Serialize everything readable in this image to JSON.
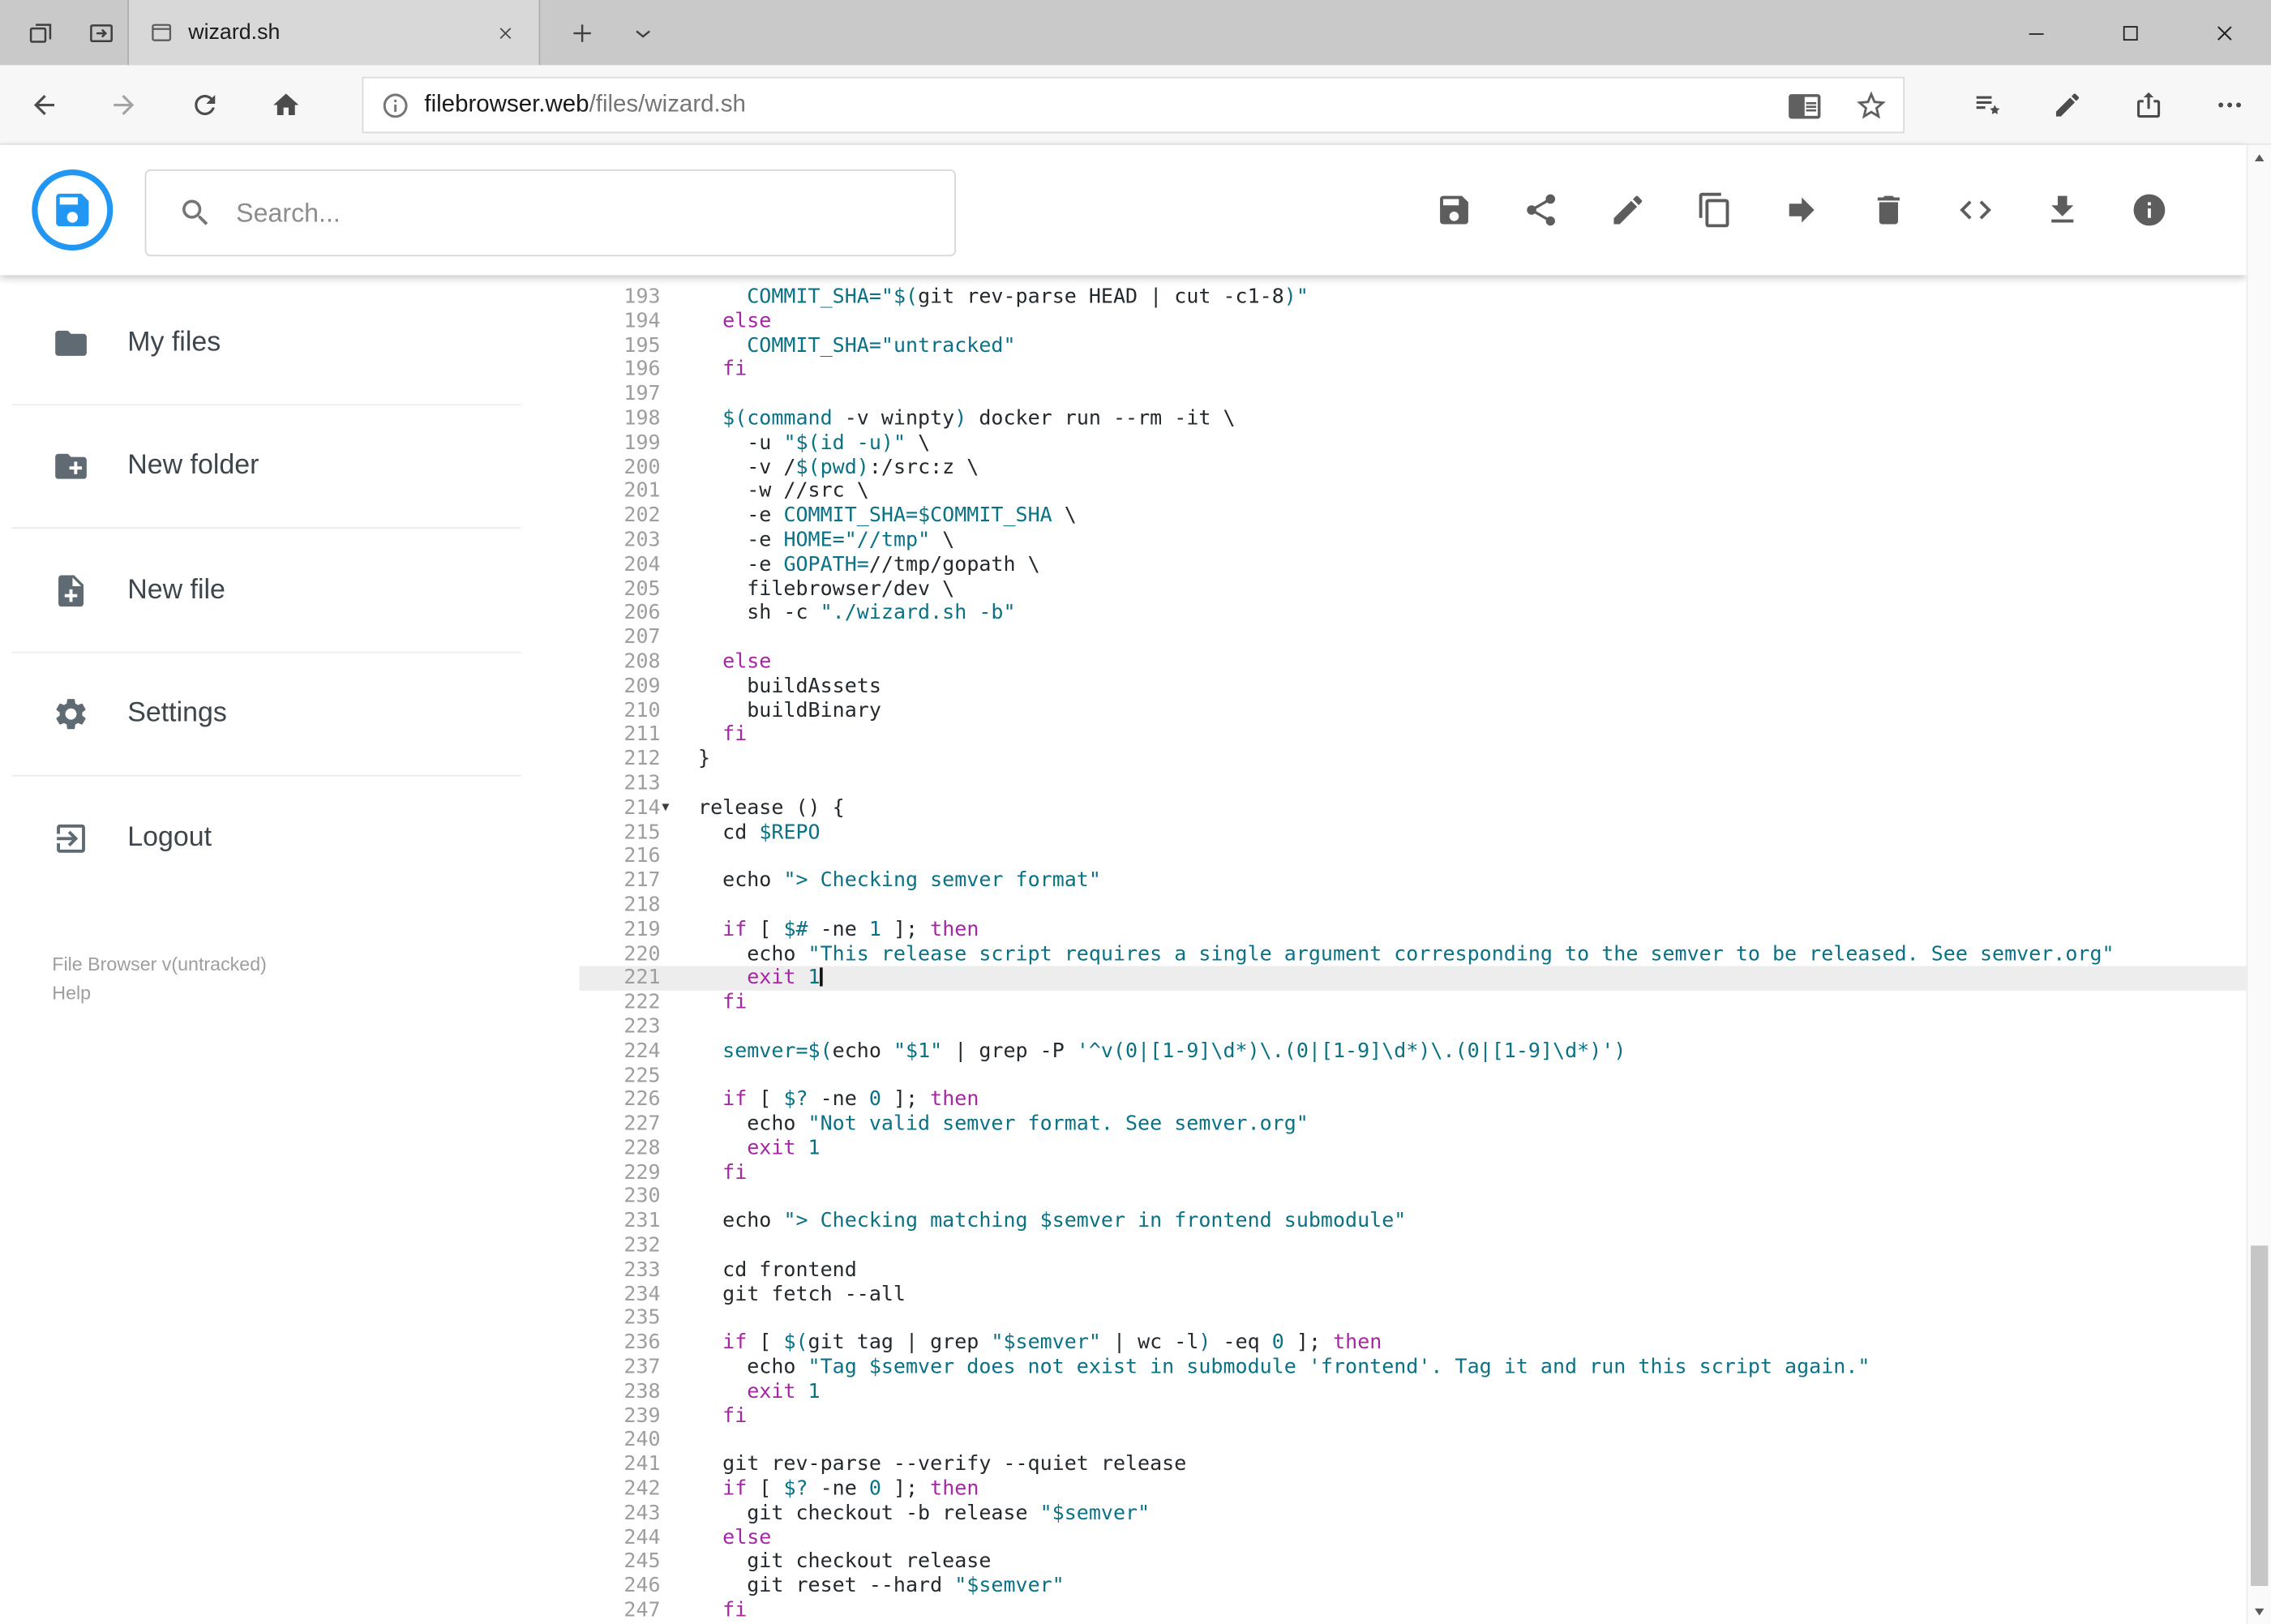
{
  "browser_tab": {
    "title": "wizard.sh"
  },
  "address_bar": {
    "domain": "filebrowser.web",
    "path": "/files/wizard.sh"
  },
  "header": {
    "search_placeholder": "Search..."
  },
  "sidebar": {
    "items": [
      {
        "label": "My files"
      },
      {
        "label": "New folder"
      },
      {
        "label": "New file"
      },
      {
        "label": "Settings"
      },
      {
        "label": "Logout"
      }
    ],
    "footer_version": "File Browser v(untracked)",
    "footer_help": "Help"
  },
  "colors": {
    "accent": "#2196f3",
    "keyword_color": "#a626a4",
    "token_color": "#0b7285"
  },
  "editor": {
    "active_line": 221,
    "cursor_line": 221,
    "fold_line": 214,
    "lines": [
      {
        "n": 193,
        "s": [
          [
            "p",
            "    "
          ],
          [
            "t",
            "COMMIT_SHA="
          ],
          [
            "t",
            "\"$("
          ],
          [
            "p",
            "git rev-parse HEAD | cut -c1-8"
          ],
          [
            "t",
            ")\""
          ]
        ]
      },
      {
        "n": 194,
        "s": [
          [
            "p",
            "  "
          ],
          [
            "k",
            "else"
          ]
        ]
      },
      {
        "n": 195,
        "s": [
          [
            "p",
            "    "
          ],
          [
            "t",
            "COMMIT_SHA="
          ],
          [
            "t",
            "\"untracked\""
          ]
        ]
      },
      {
        "n": 196,
        "s": [
          [
            "p",
            "  "
          ],
          [
            "k",
            "fi"
          ]
        ]
      },
      {
        "n": 197,
        "s": []
      },
      {
        "n": 198,
        "s": [
          [
            "p",
            "  "
          ],
          [
            "t",
            "$(command"
          ],
          [
            "p",
            " -v winpty"
          ],
          [
            "t",
            ")"
          ],
          [
            "p",
            " docker run --rm -it \\"
          ]
        ]
      },
      {
        "n": 199,
        "s": [
          [
            "p",
            "    -u "
          ],
          [
            "t",
            "\"$(id -u)\""
          ],
          [
            "p",
            " \\"
          ]
        ]
      },
      {
        "n": 200,
        "s": [
          [
            "p",
            "    -v /"
          ],
          [
            "t",
            "$(pwd)"
          ],
          [
            "p",
            ":/src:z \\"
          ]
        ]
      },
      {
        "n": 201,
        "s": [
          [
            "p",
            "    -w //src \\"
          ]
        ]
      },
      {
        "n": 202,
        "s": [
          [
            "p",
            "    -e "
          ],
          [
            "t",
            "COMMIT_SHA=$COMMIT_SHA"
          ],
          [
            "p",
            " \\"
          ]
        ]
      },
      {
        "n": 203,
        "s": [
          [
            "p",
            "    -e "
          ],
          [
            "t",
            "HOME="
          ],
          [
            "t",
            "\"//tmp\""
          ],
          [
            "p",
            " \\"
          ]
        ]
      },
      {
        "n": 204,
        "s": [
          [
            "p",
            "    -e "
          ],
          [
            "t",
            "GOPATH="
          ],
          [
            "p",
            "//tmp/gopath \\"
          ]
        ]
      },
      {
        "n": 205,
        "s": [
          [
            "p",
            "    filebrowser/dev \\"
          ]
        ]
      },
      {
        "n": 206,
        "s": [
          [
            "p",
            "    sh -c "
          ],
          [
            "t",
            "\"./wizard.sh -b\""
          ]
        ]
      },
      {
        "n": 207,
        "s": []
      },
      {
        "n": 208,
        "s": [
          [
            "p",
            "  "
          ],
          [
            "k",
            "else"
          ]
        ]
      },
      {
        "n": 209,
        "s": [
          [
            "p",
            "    buildAssets"
          ]
        ]
      },
      {
        "n": 210,
        "s": [
          [
            "p",
            "    buildBinary"
          ]
        ]
      },
      {
        "n": 211,
        "s": [
          [
            "p",
            "  "
          ],
          [
            "k",
            "fi"
          ]
        ]
      },
      {
        "n": 212,
        "s": [
          [
            "p",
            "}"
          ]
        ]
      },
      {
        "n": 213,
        "s": []
      },
      {
        "n": 214,
        "s": [
          [
            "p",
            "release () {"
          ]
        ]
      },
      {
        "n": 215,
        "s": [
          [
            "p",
            "  cd "
          ],
          [
            "t",
            "$REPO"
          ]
        ]
      },
      {
        "n": 216,
        "s": []
      },
      {
        "n": 217,
        "s": [
          [
            "p",
            "  echo "
          ],
          [
            "t",
            "\"> Checking semver format\""
          ]
        ]
      },
      {
        "n": 218,
        "s": []
      },
      {
        "n": 219,
        "s": [
          [
            "p",
            "  "
          ],
          [
            "k",
            "if"
          ],
          [
            "p",
            " [ "
          ],
          [
            "t",
            "$#"
          ],
          [
            "p",
            " -ne "
          ],
          [
            "t",
            "1"
          ],
          [
            "p",
            " ]; "
          ],
          [
            "k",
            "then"
          ]
        ]
      },
      {
        "n": 220,
        "s": [
          [
            "p",
            "    echo "
          ],
          [
            "t",
            "\"This release script requires a single argument corresponding to the semver to be released. See semver.org\""
          ]
        ]
      },
      {
        "n": 221,
        "s": [
          [
            "p",
            "    "
          ],
          [
            "k",
            "exit"
          ],
          [
            "p",
            " "
          ],
          [
            "t",
            "1"
          ]
        ]
      },
      {
        "n": 222,
        "s": [
          [
            "p",
            "  "
          ],
          [
            "k",
            "fi"
          ]
        ]
      },
      {
        "n": 223,
        "s": []
      },
      {
        "n": 224,
        "s": [
          [
            "p",
            "  "
          ],
          [
            "t",
            "semver=$("
          ],
          [
            "p",
            "echo "
          ],
          [
            "t",
            "\"$1\""
          ],
          [
            "p",
            " | grep -P "
          ],
          [
            "t",
            "'^v(0|[1-9]\\d*)\\.(0|[1-9]\\d*)\\.(0|[1-9]\\d*)'"
          ],
          [
            "t",
            ")"
          ]
        ]
      },
      {
        "n": 225,
        "s": []
      },
      {
        "n": 226,
        "s": [
          [
            "p",
            "  "
          ],
          [
            "k",
            "if"
          ],
          [
            "p",
            " [ "
          ],
          [
            "t",
            "$?"
          ],
          [
            "p",
            " -ne "
          ],
          [
            "t",
            "0"
          ],
          [
            "p",
            " ]; "
          ],
          [
            "k",
            "then"
          ]
        ]
      },
      {
        "n": 227,
        "s": [
          [
            "p",
            "    echo "
          ],
          [
            "t",
            "\"Not valid semver format. See semver.org\""
          ]
        ]
      },
      {
        "n": 228,
        "s": [
          [
            "p",
            "    "
          ],
          [
            "k",
            "exit"
          ],
          [
            "p",
            " "
          ],
          [
            "t",
            "1"
          ]
        ]
      },
      {
        "n": 229,
        "s": [
          [
            "p",
            "  "
          ],
          [
            "k",
            "fi"
          ]
        ]
      },
      {
        "n": 230,
        "s": []
      },
      {
        "n": 231,
        "s": [
          [
            "p",
            "  echo "
          ],
          [
            "t",
            "\"> Checking matching $semver in frontend submodule\""
          ]
        ]
      },
      {
        "n": 232,
        "s": []
      },
      {
        "n": 233,
        "s": [
          [
            "p",
            "  cd frontend"
          ]
        ]
      },
      {
        "n": 234,
        "s": [
          [
            "p",
            "  git fetch --all"
          ]
        ]
      },
      {
        "n": 235,
        "s": []
      },
      {
        "n": 236,
        "s": [
          [
            "p",
            "  "
          ],
          [
            "k",
            "if"
          ],
          [
            "p",
            " [ "
          ],
          [
            "t",
            "$("
          ],
          [
            "p",
            "git tag | grep "
          ],
          [
            "t",
            "\"$semver\""
          ],
          [
            "p",
            " | wc -l"
          ],
          [
            "t",
            ")"
          ],
          [
            "p",
            " -eq "
          ],
          [
            "t",
            "0"
          ],
          [
            "p",
            " ]; "
          ],
          [
            "k",
            "then"
          ]
        ]
      },
      {
        "n": 237,
        "s": [
          [
            "p",
            "    echo "
          ],
          [
            "t",
            "\"Tag $semver does not exist in submodule 'frontend'. Tag it and run this script again.\""
          ]
        ]
      },
      {
        "n": 238,
        "s": [
          [
            "p",
            "    "
          ],
          [
            "k",
            "exit"
          ],
          [
            "p",
            " "
          ],
          [
            "t",
            "1"
          ]
        ]
      },
      {
        "n": 239,
        "s": [
          [
            "p",
            "  "
          ],
          [
            "k",
            "fi"
          ]
        ]
      },
      {
        "n": 240,
        "s": []
      },
      {
        "n": 241,
        "s": [
          [
            "p",
            "  git rev-parse --verify --quiet release"
          ]
        ]
      },
      {
        "n": 242,
        "s": [
          [
            "p",
            "  "
          ],
          [
            "k",
            "if"
          ],
          [
            "p",
            " [ "
          ],
          [
            "t",
            "$?"
          ],
          [
            "p",
            " -ne "
          ],
          [
            "t",
            "0"
          ],
          [
            "p",
            " ]; "
          ],
          [
            "k",
            "then"
          ]
        ]
      },
      {
        "n": 243,
        "s": [
          [
            "p",
            "    git checkout -b release "
          ],
          [
            "t",
            "\"$semver\""
          ]
        ]
      },
      {
        "n": 244,
        "s": [
          [
            "p",
            "  "
          ],
          [
            "k",
            "else"
          ]
        ]
      },
      {
        "n": 245,
        "s": [
          [
            "p",
            "    git checkout release"
          ]
        ]
      },
      {
        "n": 246,
        "s": [
          [
            "p",
            "    git reset --hard "
          ],
          [
            "t",
            "\"$semver\""
          ]
        ]
      },
      {
        "n": 247,
        "s": [
          [
            "p",
            "  "
          ],
          [
            "k",
            "fi"
          ]
        ]
      }
    ]
  }
}
